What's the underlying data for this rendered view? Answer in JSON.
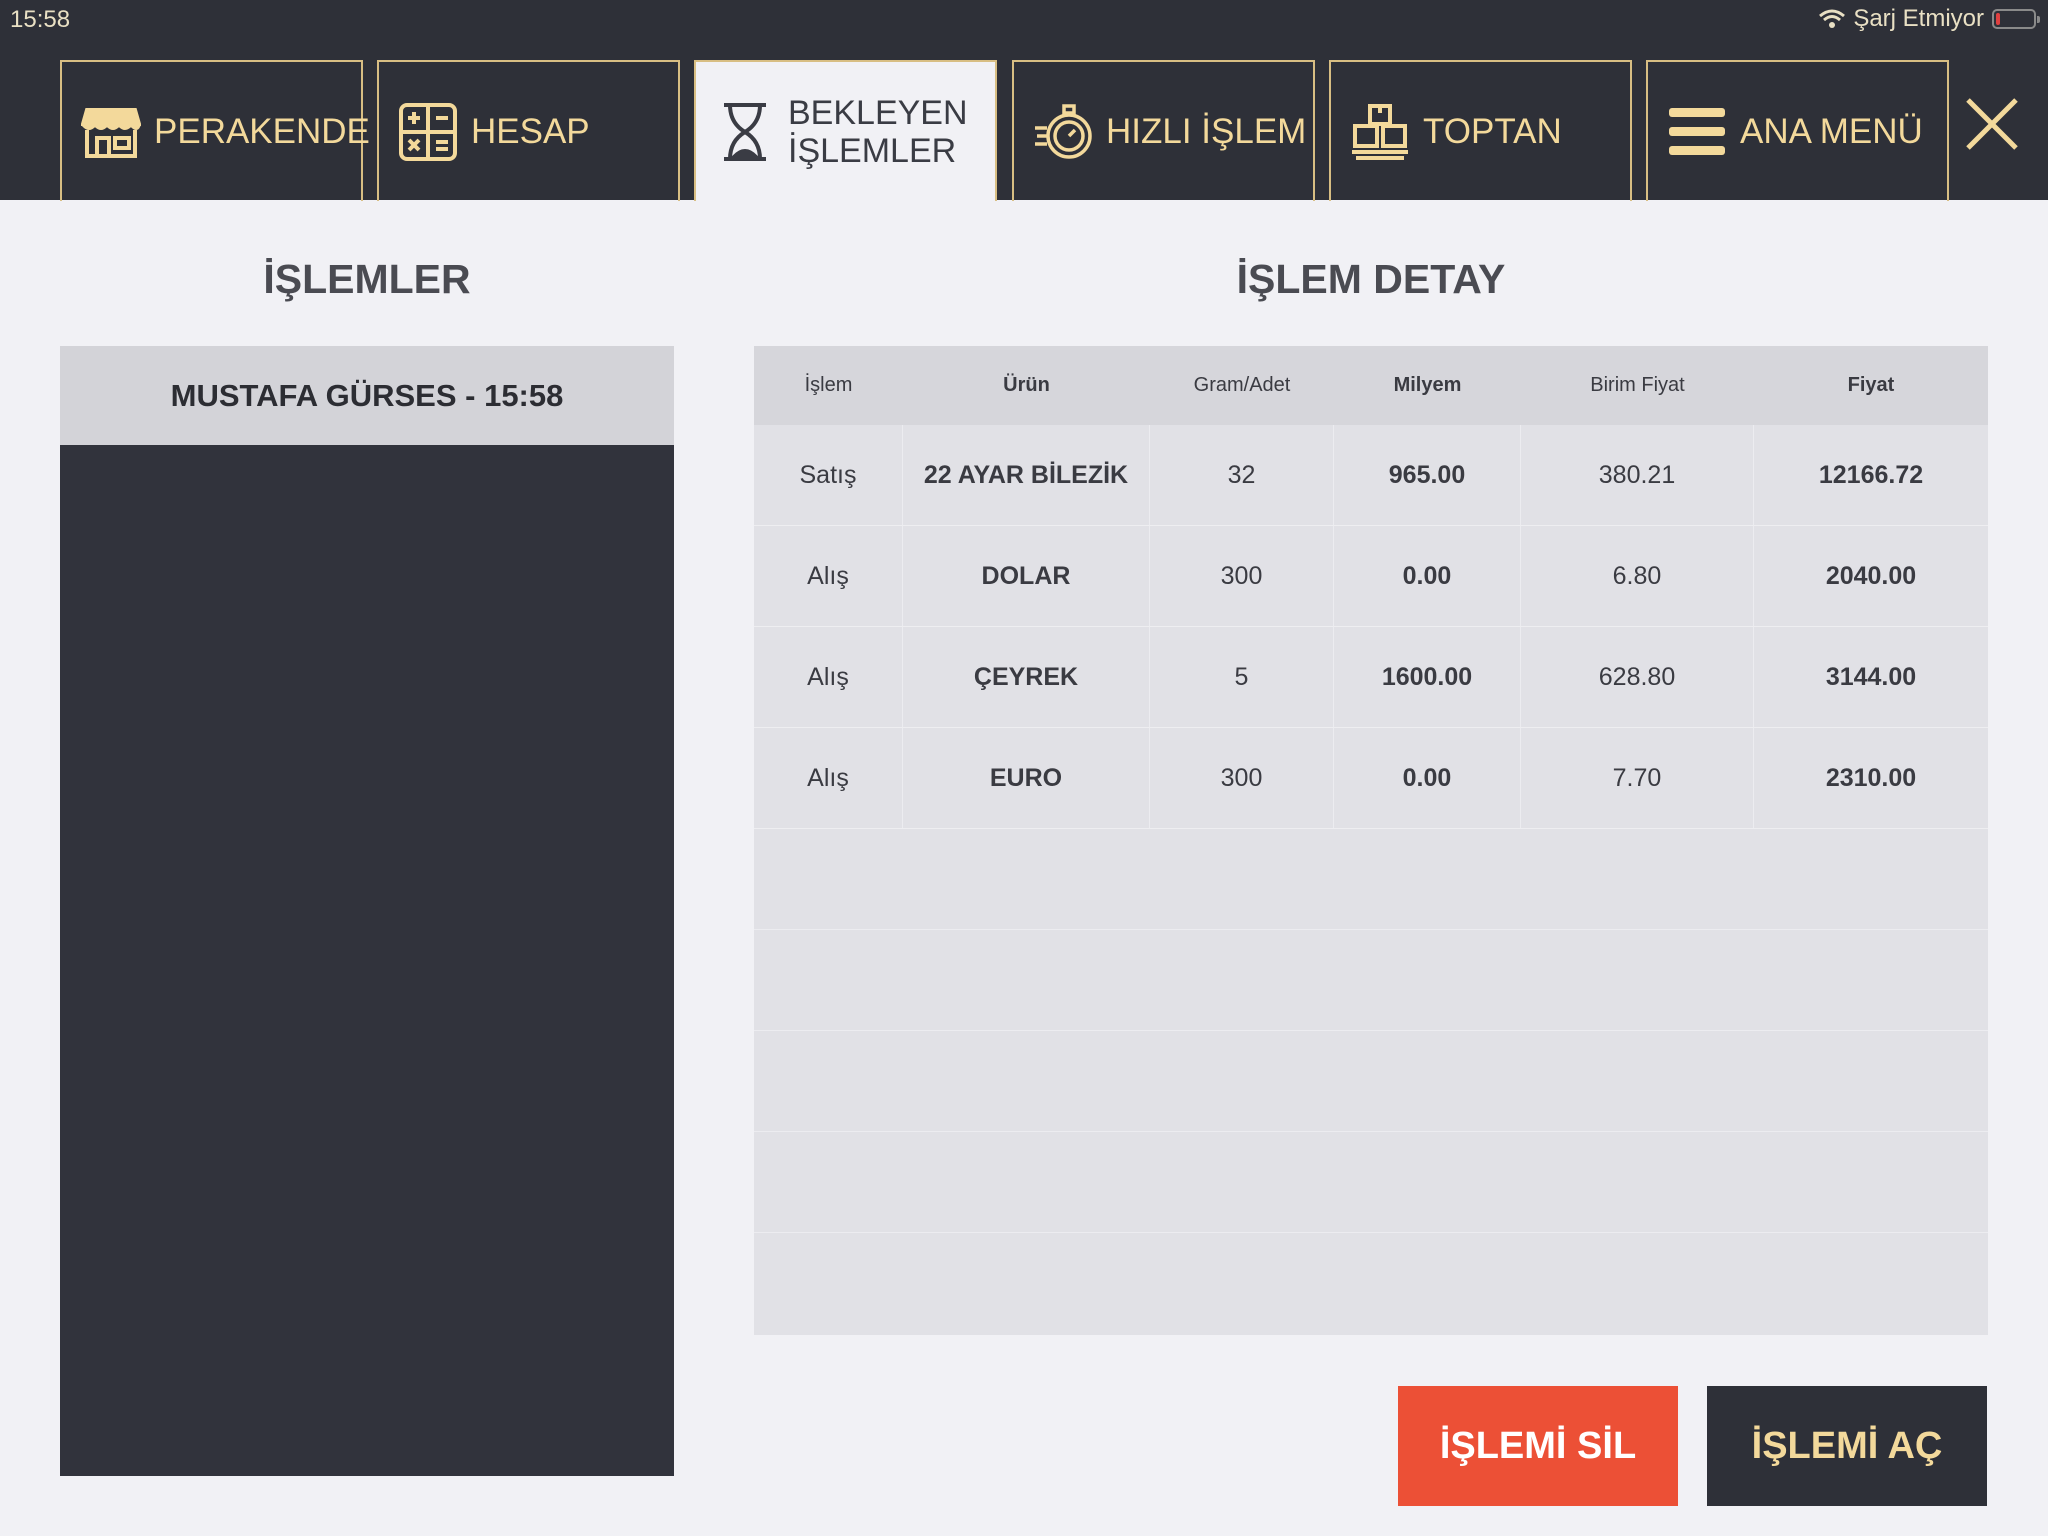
{
  "status": {
    "time": "15:58",
    "charging": "Şarj Etmiyor"
  },
  "tabs": [
    {
      "label": "PERAKENDE",
      "icon": "store-icon"
    },
    {
      "label": "HESAP",
      "icon": "calculator-icon"
    },
    {
      "label_line1": "BEKLEYEN",
      "label_line2": "İŞLEMLER",
      "icon": "hourglass-icon",
      "active": true
    },
    {
      "label": "HIZLI İŞLEM",
      "icon": "stopwatch-icon"
    },
    {
      "label": "TOPTAN",
      "icon": "boxes-icon"
    },
    {
      "label": "ANA MENÜ",
      "icon": "menu-icon"
    }
  ],
  "left": {
    "title": "İŞLEMLER",
    "items": [
      "MUSTAFA GÜRSES - 15:58"
    ]
  },
  "right": {
    "title": "İŞLEM DETAY",
    "headers": [
      "İşlem",
      "Ürün",
      "Gram/Adet",
      "Milyem",
      "Birim Fiyat",
      "Fiyat"
    ],
    "rows": [
      [
        "Satış",
        "22 AYAR BİLEZİK",
        "32",
        "965.00",
        "380.21",
        "12166.72"
      ],
      [
        "Alış",
        "DOLAR",
        "300",
        "0.00",
        "6.80",
        "2040.00"
      ],
      [
        "Alış",
        "ÇEYREK",
        "5",
        "1600.00",
        "628.80",
        "3144.00"
      ],
      [
        "Alış",
        "EURO",
        "300",
        "0.00",
        "7.70",
        "2310.00"
      ]
    ]
  },
  "buttons": {
    "delete": "İŞLEMİ SİL",
    "open": "İŞLEMİ AÇ"
  },
  "colors": {
    "dark": "#2e3038",
    "gold": "#f3d99b",
    "delete": "#ec5036"
  }
}
